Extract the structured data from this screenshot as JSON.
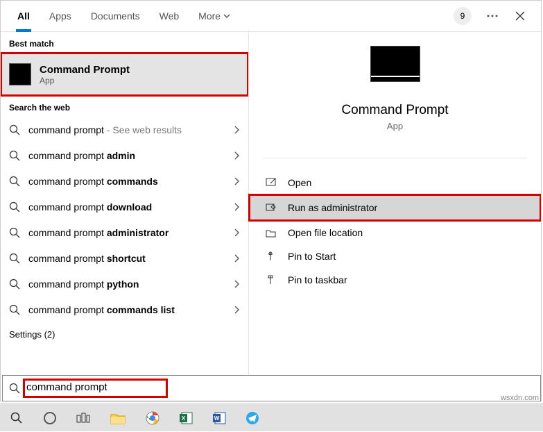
{
  "tabs": {
    "all": "All",
    "apps": "Apps",
    "documents": "Documents",
    "web": "Web",
    "more": "More"
  },
  "badge": "9",
  "groups": {
    "best": "Best match",
    "web": "Search the web",
    "settings": "Settings (2)"
  },
  "bestMatch": {
    "title": "Command Prompt",
    "sub": "App"
  },
  "webResults": [
    {
      "prefix": "command prompt",
      "bold": "",
      "hint": " - See web results"
    },
    {
      "prefix": "command prompt ",
      "bold": "admin",
      "hint": ""
    },
    {
      "prefix": "command prompt ",
      "bold": "commands",
      "hint": ""
    },
    {
      "prefix": "command prompt ",
      "bold": "download",
      "hint": ""
    },
    {
      "prefix": "command prompt ",
      "bold": "administrator",
      "hint": ""
    },
    {
      "prefix": "command prompt ",
      "bold": "shortcut",
      "hint": ""
    },
    {
      "prefix": "command prompt ",
      "bold": "python",
      "hint": ""
    },
    {
      "prefix": "command prompt ",
      "bold": "commands list",
      "hint": ""
    }
  ],
  "preview": {
    "title": "Command Prompt",
    "sub": "App"
  },
  "actions": {
    "open": "Open",
    "runAdmin": "Run as administrator",
    "openLoc": "Open file location",
    "pinStart": "Pin to Start",
    "pinTaskbar": "Pin to taskbar"
  },
  "searchValue": "command prompt",
  "watermark": "wsxdn.com"
}
